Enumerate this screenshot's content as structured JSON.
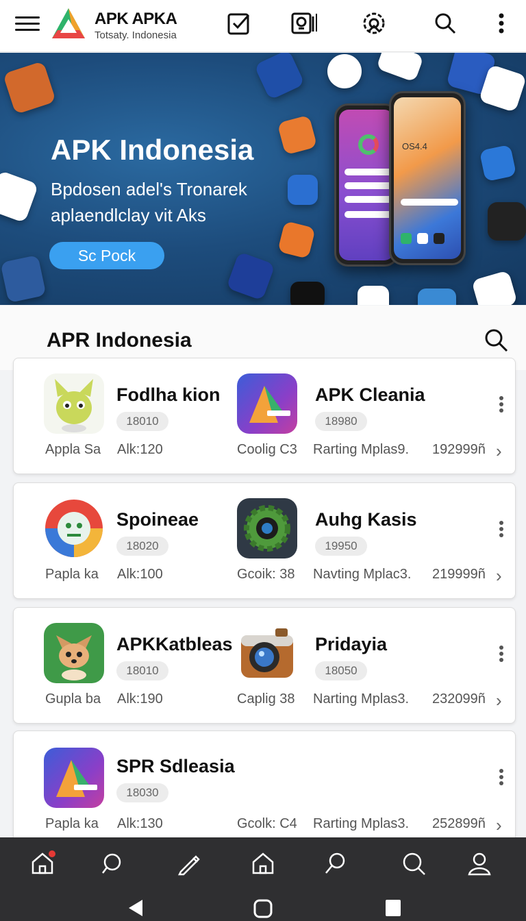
{
  "header": {
    "brand_title": "APK APKA",
    "brand_subtitle": "Totsaty. Indonesia",
    "icons": [
      "menu-icon",
      "logo-icon",
      "checkbox-icon",
      "camera-icon",
      "settings-icon",
      "search-icon",
      "more-vert-icon"
    ]
  },
  "hero": {
    "title": "APK Indonesia",
    "text": "Bpdosen adel's Tronarek aplaendlclay vit Aks",
    "button": "Sc Pock",
    "phone_label": "OS4.4"
  },
  "section": {
    "title": "APR Indonesia"
  },
  "rows": [
    {
      "apps": [
        {
          "name": "Fodlha kion",
          "badge": "18010"
        },
        {
          "name": "APK Cleania",
          "badge": "18980"
        }
      ],
      "meta": [
        "Appla Sa",
        "Alk:120",
        "Coolig C3",
        "Rarting Mplas9.",
        "192999ñ"
      ]
    },
    {
      "apps": [
        {
          "name": "Spoineae",
          "badge": "18020"
        },
        {
          "name": "Auhg Kasis",
          "badge": "19950"
        }
      ],
      "meta": [
        "Papla ka",
        "Alk:100",
        "Gcoik: 38",
        "Navting Mplac3.",
        "219999ñ"
      ]
    },
    {
      "apps": [
        {
          "name": "APKKatbleas",
          "badge": "18010"
        },
        {
          "name": "Pridayia",
          "badge": "18050"
        }
      ],
      "meta": [
        "Gupla ba",
        "Alk:190",
        "Caplig 38",
        "Narting Mplas3.",
        "232099ñ"
      ]
    },
    {
      "apps": [
        {
          "name": "SPR Sdleasia",
          "badge": "18030"
        }
      ],
      "meta": [
        "Papla ka",
        "Alk:130",
        "Gcolk: C4",
        "Rarting Mplas3.",
        "252899ñ"
      ]
    }
  ],
  "colors": {
    "accent": "#3aa0f0",
    "nav_bg": "#2f2f31",
    "hero_bg": "#1d4c7c",
    "badge_dot": "#e53935"
  }
}
